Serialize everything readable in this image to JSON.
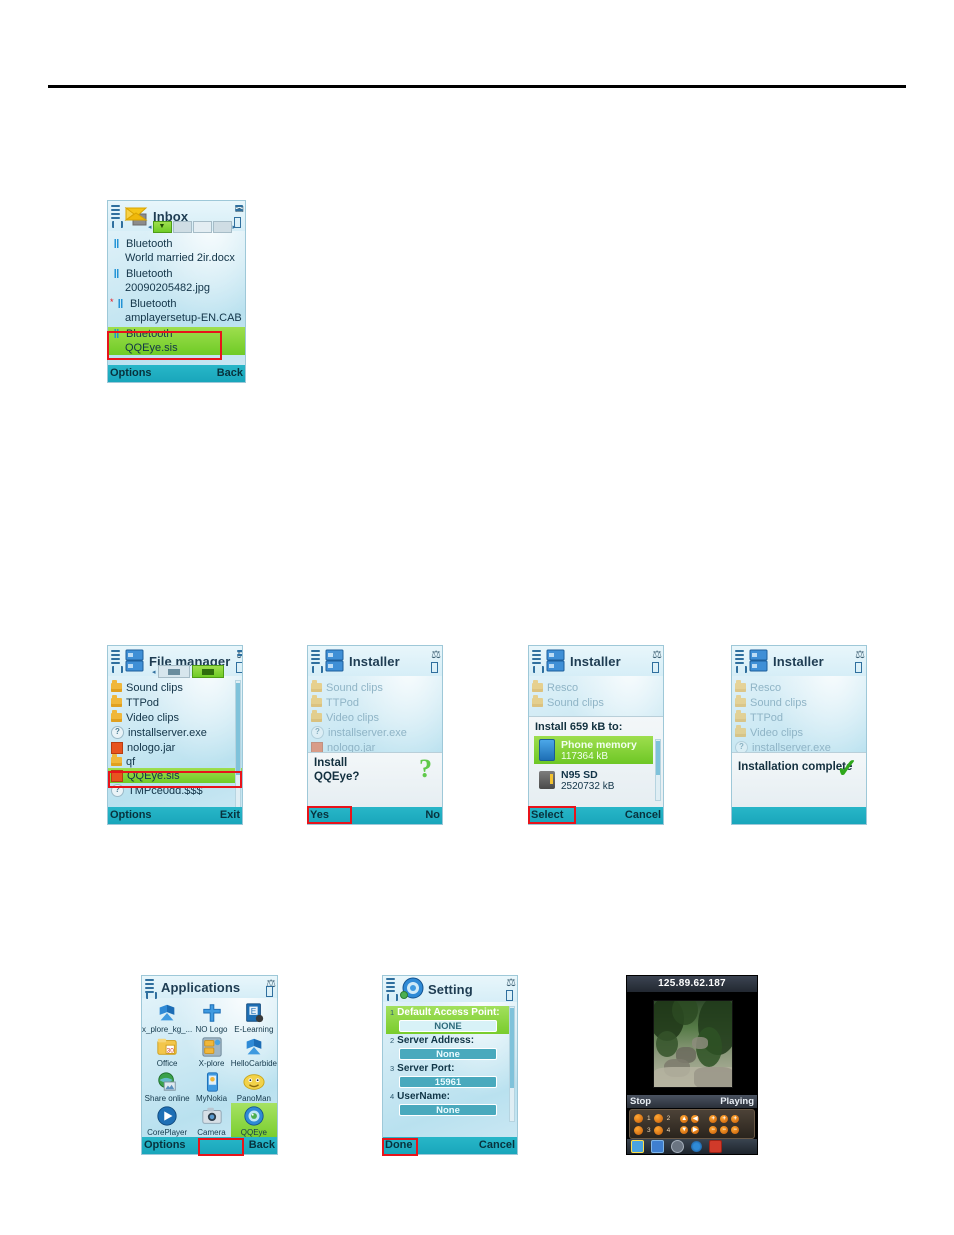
{
  "page": {
    "background": "#ffffff",
    "rule_color": "#000000"
  },
  "colors": {
    "highlight_green": "#7ace2f",
    "redbox": "#e8131a",
    "softkey_bar": "#19a6bb",
    "title_text": "#1e3c52"
  },
  "screens": {
    "inbox": {
      "title": "Inbox",
      "app_icon": "envelope-icon",
      "tabs": [
        "inbox-tab-icon",
        "sent-tab-icon",
        "drafts-tab-icon",
        "outbox-tab-icon"
      ],
      "messages": [
        {
          "sender": "Bluetooth",
          "file": "World married 2ir.docx",
          "selected": false,
          "unread_mark": false
        },
        {
          "sender": "Bluetooth",
          "file": "20090205482.jpg",
          "selected": false,
          "unread_mark": false
        },
        {
          "sender": "Bluetooth",
          "file": "amplayersetup-EN.CAB",
          "selected": false,
          "unread_mark": true
        },
        {
          "sender": "Bluetooth",
          "file": "QQEye.sis",
          "selected": true,
          "unread_mark": false
        }
      ],
      "softkey_left": "Options",
      "softkey_right": "Back"
    },
    "file_manager": {
      "title": "File manager",
      "app_icon": "file-manager-icon",
      "items": [
        {
          "label": "Sound clips",
          "icon": "folder-icon",
          "selected": false
        },
        {
          "label": "TTPod",
          "icon": "folder-icon",
          "selected": false
        },
        {
          "label": "Video clips",
          "icon": "folder-icon",
          "selected": false
        },
        {
          "label": "installserver.exe",
          "icon": "unknown-file-icon",
          "selected": false
        },
        {
          "label": "nologo.jar",
          "icon": "jar-file-icon",
          "selected": false
        },
        {
          "label": "qf",
          "icon": "folder-icon",
          "selected": false
        },
        {
          "label": "QQEye.sis",
          "icon": "sis-file-icon",
          "selected": true
        },
        {
          "label": "TMPce0dd.$$$",
          "icon": "unknown-file-icon",
          "selected": false
        }
      ],
      "softkey_left": "Options",
      "softkey_right": "Exit"
    },
    "installer_confirm": {
      "title": "Installer",
      "app_icon": "file-manager-icon",
      "background_items": [
        {
          "label": "Sound clips",
          "icon": "folder-icon"
        },
        {
          "label": "TTPod",
          "icon": "folder-icon"
        },
        {
          "label": "Video clips",
          "icon": "folder-icon"
        },
        {
          "label": "installserver.exe",
          "icon": "unknown-file-icon"
        },
        {
          "label": "nologo.jar",
          "icon": "jar-file-icon"
        }
      ],
      "dialog_line1": "Install",
      "dialog_line2": "QQEye?",
      "dialog_icon": "question-mark-icon",
      "softkey_left": "Yes",
      "softkey_right": "No"
    },
    "installer_memory": {
      "title": "Installer",
      "app_icon": "file-manager-icon",
      "background_items": [
        {
          "label": "Resco",
          "icon": "folder-icon"
        },
        {
          "label": "Sound clips",
          "icon": "folder-icon"
        }
      ],
      "dialog_title": "Install 659 kB to:",
      "options": [
        {
          "name": "Phone memory",
          "size": "117364 kB",
          "icon": "phone-memory-icon",
          "selected": true
        },
        {
          "name": "N95 SD",
          "size": "2520732 kB",
          "icon": "memory-card-icon",
          "selected": false
        }
      ],
      "softkey_left": "Select",
      "softkey_right": "Cancel"
    },
    "installer_complete": {
      "title": "Installer",
      "app_icon": "file-manager-icon",
      "background_items": [
        {
          "label": "Resco",
          "icon": "folder-icon"
        },
        {
          "label": "Sound clips",
          "icon": "folder-icon"
        },
        {
          "label": "TTPod",
          "icon": "folder-icon"
        },
        {
          "label": "Video clips",
          "icon": "folder-icon"
        },
        {
          "label": "installserver.exe",
          "icon": "unknown-file-icon"
        }
      ],
      "dialog_text": "Installation complete",
      "dialog_icon": "green-check-icon",
      "softkey_left": "",
      "softkey_right": ""
    },
    "applications": {
      "title": "Applications",
      "apps": [
        {
          "label": "x_plore_kg_...",
          "icon": "x-plore-keygen-icon",
          "selected": false
        },
        {
          "label": "NO Logo",
          "icon": "no-logo-icon",
          "selected": false
        },
        {
          "label": "E-Learning",
          "icon": "e-learning-icon",
          "selected": false
        },
        {
          "label": "Office",
          "icon": "office-icon",
          "selected": false
        },
        {
          "label": "X-plore",
          "icon": "x-plore-icon",
          "selected": false
        },
        {
          "label": "HelloCarbide",
          "icon": "hello-carbide-icon",
          "selected": false
        },
        {
          "label": "Share online",
          "icon": "share-online-icon",
          "selected": false
        },
        {
          "label": "MyNokia",
          "icon": "my-nokia-icon",
          "selected": false
        },
        {
          "label": "PanoMan",
          "icon": "panoman-icon",
          "selected": false
        },
        {
          "label": "CorePlayer",
          "icon": "core-player-icon",
          "selected": false
        },
        {
          "label": "Camera",
          "icon": "camera-icon",
          "selected": false
        },
        {
          "label": "QQEye",
          "icon": "qqeye-icon",
          "selected": true
        }
      ],
      "softkey_left": "Options",
      "softkey_right": "Back"
    },
    "setting": {
      "title": "Setting",
      "app_icon": "qqeye-icon",
      "fields": [
        {
          "num": "1",
          "label": "Default Access Point:",
          "value": "NONE",
          "selected": true
        },
        {
          "num": "2",
          "label": "Server Address:",
          "value": "None",
          "selected": false
        },
        {
          "num": "3",
          "label": "Server Port:",
          "value": "15961",
          "selected": false
        },
        {
          "num": "4",
          "label": "UserName:",
          "value": "None",
          "selected": false
        }
      ],
      "softkey_left": "Done",
      "softkey_right": "Cancel"
    },
    "viewer": {
      "title": "125.89.62.187",
      "status_left": "Stop",
      "status_right": "Playing",
      "preset_buttons": [
        "1",
        "2",
        "3",
        "4"
      ],
      "pan_buttons": [
        "up-arrow-icon",
        "left-arrow-icon",
        "down-arrow-icon",
        "right-arrow-icon"
      ],
      "zoom_buttons": [
        "plus-icon",
        "plus-icon",
        "plus-icon",
        "minus-icon",
        "minus-icon",
        "minus-icon"
      ],
      "toolbar": [
        "snapshot-icon",
        "image-icon",
        "record-icon",
        "settings-icon",
        "exit-icon"
      ]
    }
  }
}
